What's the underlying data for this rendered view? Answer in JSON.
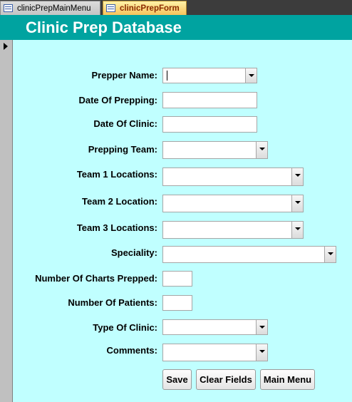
{
  "tabs": [
    {
      "label": "clinicPrepMainMenu",
      "active": false
    },
    {
      "label": "clinicPrepForm",
      "active": true
    }
  ],
  "form": {
    "title": "Clinic Prep Database",
    "fields": {
      "prepper_name": {
        "label": "Prepper Name:",
        "value": ""
      },
      "date_of_prepping": {
        "label": "Date Of Prepping:",
        "value": ""
      },
      "date_of_clinic": {
        "label": "Date Of Clinic:",
        "value": ""
      },
      "prepping_team": {
        "label": "Prepping Team:",
        "value": ""
      },
      "team1_locations": {
        "label": "Team 1 Locations:",
        "value": ""
      },
      "team2_location": {
        "label": "Team 2 Location:",
        "value": ""
      },
      "team3_locations": {
        "label": "Team 3 Locations:",
        "value": ""
      },
      "speciality": {
        "label": "Speciality:",
        "value": ""
      },
      "charts_prepped": {
        "label": "Number Of Charts Prepped:",
        "value": ""
      },
      "num_patients": {
        "label": "Number Of Patients:",
        "value": ""
      },
      "type_of_clinic": {
        "label": "Type Of Clinic:",
        "value": ""
      },
      "comments": {
        "label": "Comments:",
        "value": ""
      }
    },
    "buttons": {
      "save": "Save",
      "clear": "Clear Fields",
      "main_menu": "Main Menu"
    }
  },
  "colors": {
    "header": "#00a3a0",
    "form_background": "#c0ffff",
    "active_tab": "#f7c35b"
  },
  "icons": [
    "form-tab-icon",
    "record-selector-arrow-icon",
    "dropdown-arrow-icon"
  ]
}
